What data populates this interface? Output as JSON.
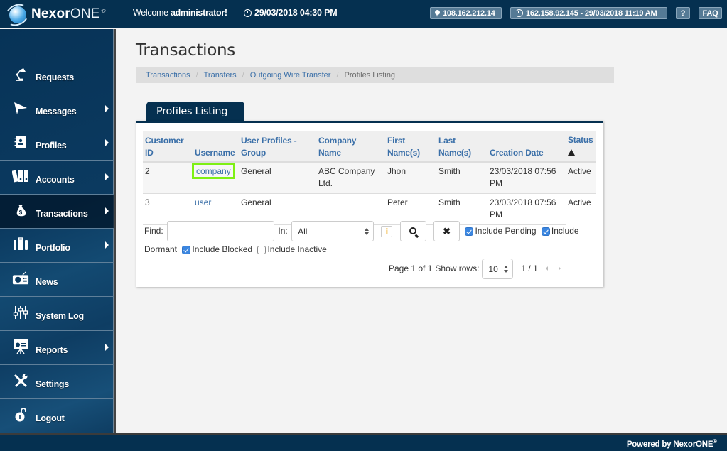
{
  "header": {
    "logo_bold": "Nexor",
    "logo_thin": "ONE",
    "logo_mark": "®",
    "welcome_prefix": "Welcome ",
    "welcome_user": "administrator!",
    "datetime": "29/03/2018 04:30 PM",
    "ip_address": "108.162.212.14",
    "last_login": "162.158.92.145 - 29/03/2018 11:19 AM",
    "help_label": "?",
    "faq_label": "FAQ",
    "icons": {
      "clock": "clock-icon",
      "ip": "map-marker-icon",
      "last_login": "history-icon"
    }
  },
  "sidebar": {
    "active": "Transactions",
    "items": [
      {
        "label": "Requests",
        "icon": "desk-lamp-icon",
        "submenu": false
      },
      {
        "label": "Messages",
        "icon": "paper-plane-icon",
        "submenu": true
      },
      {
        "label": "Profiles",
        "icon": "address-book-icon",
        "submenu": true
      },
      {
        "label": "Accounts",
        "icon": "binders-icon",
        "submenu": true
      },
      {
        "label": "Transactions",
        "icon": "money-bag-icon",
        "submenu": true
      },
      {
        "label": "Portfolio",
        "icon": "briefcase-icon",
        "submenu": true
      },
      {
        "label": "News",
        "icon": "radio-icon",
        "submenu": false
      },
      {
        "label": "System Log",
        "icon": "sliders-icon",
        "submenu": false
      },
      {
        "label": "Reports",
        "icon": "presentation-board-icon",
        "submenu": true
      },
      {
        "label": "Settings",
        "icon": "tools-icon",
        "submenu": false
      },
      {
        "label": "Logout",
        "icon": "unlock-icon",
        "submenu": false
      }
    ]
  },
  "main": {
    "page_title": "Transactions",
    "breadcrumb": [
      {
        "label": "Transactions",
        "link": true
      },
      {
        "label": "Transfers",
        "link": true
      },
      {
        "label": "Outgoing Wire Transfer",
        "link": true
      },
      {
        "label": "Profiles Listing",
        "link": false
      }
    ],
    "breadcrumb_separator": "/",
    "panel_title": "Profiles Listing",
    "table": {
      "columns": [
        {
          "line1": "Customer",
          "line2": "ID"
        },
        {
          "line1": "",
          "line2": "Username"
        },
        {
          "line1": "User Profiles -",
          "line2": "Group"
        },
        {
          "line1": "Company",
          "line2": "Name"
        },
        {
          "line1": "First",
          "line2": "Name(s)"
        },
        {
          "line1": "Last",
          "line2": "Name(s)"
        },
        {
          "line1": "",
          "line2": "Creation Date"
        },
        {
          "line1": "Status",
          "line2": "▲",
          "sorted": "ascending"
        }
      ],
      "rows": [
        {
          "customer_id": "2",
          "username": "company",
          "group": "General",
          "company_line1": "ABC Company",
          "company_line2": "Ltd.",
          "first_name": "Jhon",
          "last_name": "Smith",
          "created_line1": "23/03/2018 07:56",
          "created_line2": "PM",
          "status": "Active",
          "highlighted": true
        },
        {
          "customer_id": "3",
          "username": "user",
          "group": "General",
          "company_line1": "",
          "company_line2": "",
          "first_name": "Peter",
          "last_name": "Smith",
          "created_line1": "23/03/2018 07:56",
          "created_line2": "PM",
          "status": "Active",
          "highlighted": false
        }
      ]
    },
    "filters": {
      "find_label": "Find:",
      "find_value": "",
      "find_placeholder": "",
      "in_label": "In:",
      "in_selected": "All",
      "info_label": "i",
      "search_button": "search-icon",
      "clear_button": "close-icon",
      "include_pending_label": "Include Pending",
      "include_pending": true,
      "include_dormant_label_1": "Include",
      "include_dormant_label_2": "Dormant",
      "include_dormant": true,
      "include_blocked_label": "Include Blocked",
      "include_blocked": true,
      "include_inactive_label": "Include Inactive",
      "include_inactive": false
    },
    "pager": {
      "page_text": "Page 1 of 1",
      "show_rows_label": "Show rows:",
      "rows_value": "10",
      "range": "1 / 1"
    }
  },
  "footer": {
    "text": "Powered by NexorONE",
    "mark": "®"
  }
}
